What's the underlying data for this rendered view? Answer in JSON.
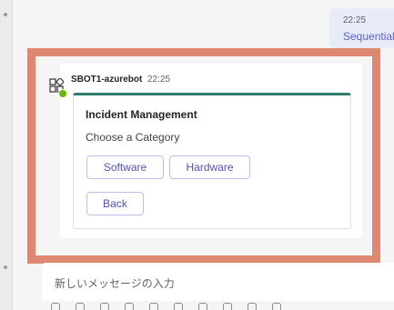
{
  "my_message": {
    "time": "22:25",
    "text": "Sequential"
  },
  "bot_message": {
    "sender": "SBOT1-azurebot",
    "time": "22:25",
    "avatar_icon": "bot-icon",
    "card": {
      "title": "Incident Management",
      "subtitle": "Choose a Category",
      "buttons": {
        "software": "Software",
        "hardware": "Hardware",
        "back": "Back"
      }
    }
  },
  "compose": {
    "placeholder": "新しいメッセージの入力"
  },
  "colors": {
    "highlight_border": "#de8872",
    "accent": "#5b5fc7",
    "card_accent": "#2e7d6f"
  }
}
